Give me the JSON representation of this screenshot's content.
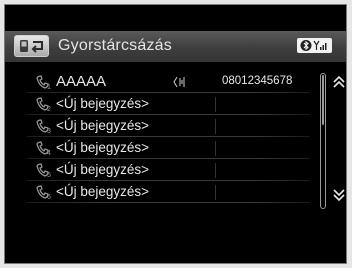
{
  "header": {
    "title": "Gyorstárcsázás",
    "back_icon": "back-arrow-icon",
    "status_icons": [
      "bluetooth-icon",
      "signal-strength-icon"
    ]
  },
  "entries": [
    {
      "index": "1",
      "name": "AAAAA",
      "number": "08012345678",
      "has_voice_tag": true
    },
    {
      "index": "2",
      "name": "<Új bejegyzés>",
      "number": "",
      "has_voice_tag": false
    },
    {
      "index": "3",
      "name": "<Új bejegyzés>",
      "number": "",
      "has_voice_tag": false
    },
    {
      "index": "4",
      "name": "<Új bejegyzés>",
      "number": "",
      "has_voice_tag": false
    },
    {
      "index": "5",
      "name": "<Új bejegyzés>",
      "number": "",
      "has_voice_tag": false
    },
    {
      "index": "6",
      "name": "<Új bejegyzés>",
      "number": "",
      "has_voice_tag": false
    }
  ],
  "scroll": {
    "up_icon": "double-chevron-up-icon",
    "down_icon": "double-chevron-down-icon",
    "position_fraction": 0.0
  },
  "colors": {
    "background": "#000000",
    "text": "#e8e8e8",
    "header": "#3e3e3e"
  }
}
